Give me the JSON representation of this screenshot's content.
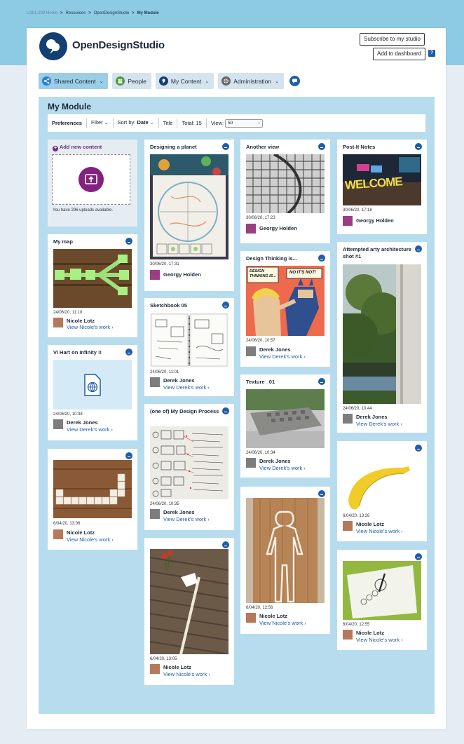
{
  "breadcrumb": {
    "home": "U101-202 Home",
    "items": [
      "Resources",
      "OpenDesignStudio",
      "My Module"
    ]
  },
  "header": {
    "app_name": "OpenDesignStudio",
    "subscribe_label": "Subscribe to my studio",
    "dashboard_label": "Add to dashboard",
    "help_label": "?"
  },
  "nav": {
    "items": [
      {
        "label": "Shared Content",
        "icon": "share-icon"
      },
      {
        "label": "People",
        "icon": "people-icon"
      },
      {
        "label": "My Content",
        "icon": "user-icon"
      },
      {
        "label": "Administration",
        "icon": "gear-icon"
      }
    ]
  },
  "module": {
    "title": "My Module",
    "preferences_label": "Preferences",
    "filter_label": "Filter",
    "sort_label": "Sort by:",
    "sort_value": "Date",
    "title_label": "Title",
    "total_label": "Total: 15",
    "view_label": "View:",
    "view_value": "50"
  },
  "add_card": {
    "label": "Add new content",
    "uploads_text": "You have 296 uploads available."
  },
  "cards": {
    "my_map": {
      "title": "My map",
      "date": "24/06/20, 11:10",
      "author": "Nicole Lotz",
      "link": "View Nicole's work"
    },
    "vi_hart": {
      "title": "Vi Hart on Infinity !!",
      "date": "24/06/20, 10:38",
      "author": "Derek Jones",
      "link": "View Derek's work"
    },
    "c1_bottom": {
      "date": "6/04/20, 13:06",
      "author": "Nicole Lotz",
      "link": "View Nicole's work"
    },
    "designing": {
      "title": "Designing a planet",
      "date": "30/06/20, 17:31",
      "author": "Georgy Holden"
    },
    "sketchbook": {
      "title": "Sketchbook 05",
      "date": "24/06/20, 11:01",
      "author": "Derek Jones",
      "link": "View Derek's work"
    },
    "process": {
      "title": "(one of) My Design Process",
      "date": "24/06/20, 10:35",
      "author": "Derek Jones",
      "link": "View Derek's work"
    },
    "c2_bottom": {
      "date": "6/04/20, 13:05",
      "author": "Nicole Lotz",
      "link": "View Nicole's work"
    },
    "another_view": {
      "title": "Another view",
      "date": "30/06/20, 17:23",
      "author": "Georgy Holden"
    },
    "design_thinking": {
      "title": "Design Thinking is...",
      "date": "24/06/20, 10:57",
      "author": "Derek Jones",
      "link": "View Derek's work",
      "bubble1": "DESIGN THINKING IS...",
      "bubble2": "NO IT'S NOT!"
    },
    "texture": {
      "title": "Texture _01",
      "date": "24/06/20, 10:34",
      "author": "Derek Jones",
      "link": "View Derek's work"
    },
    "c3_bottom": {
      "date": "6/04/20, 12:56",
      "author": "Nicole Lotz",
      "link": "View Nicole's work"
    },
    "postit": {
      "title": "Post-It Notes",
      "date": "30/06/20, 17:18",
      "author": "Georgy Holden",
      "banner": "WELCOME"
    },
    "arty": {
      "title": "Attempted arty architecture shot #1",
      "date": "24/06/20, 10:44",
      "author": "Derek Jones",
      "link": "View Derek's work"
    },
    "banana": {
      "date": "6/04/20, 13:26",
      "author": "Nicole Lotz",
      "link": "View Nicole's work"
    },
    "c4_bottom": {
      "date": "6/04/20, 12:55",
      "author": "Nicole Lotz",
      "link": "View Nicole's work"
    }
  }
}
